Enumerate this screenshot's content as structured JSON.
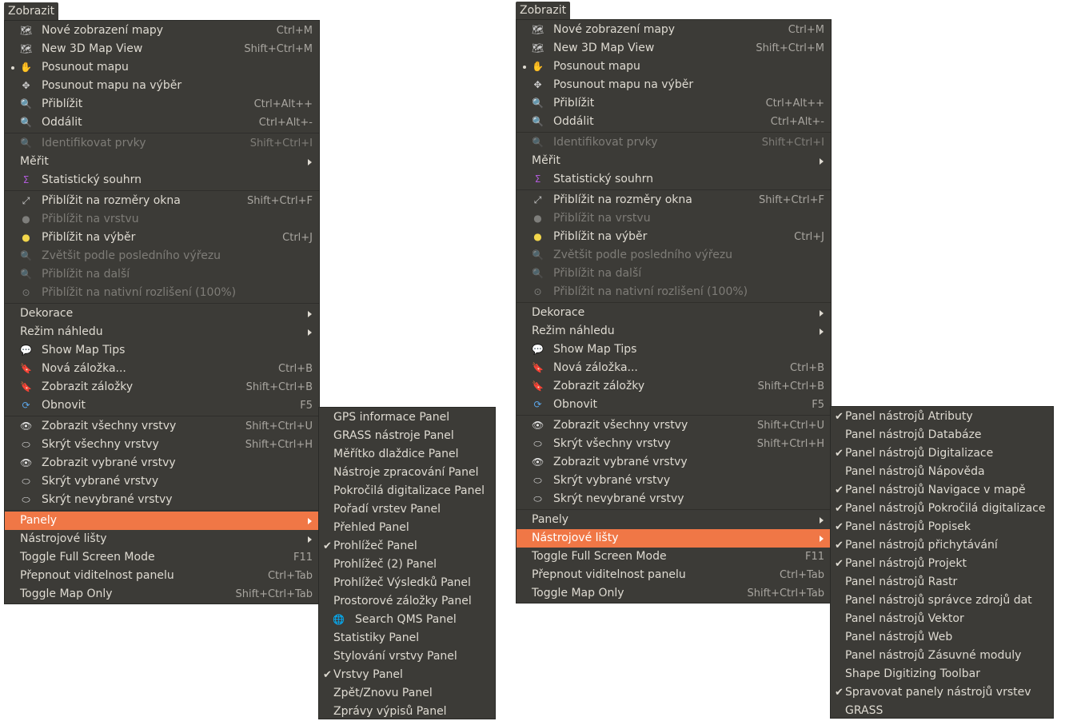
{
  "left": {
    "menu_title": "Zobrazit",
    "items": [
      {
        "label": "Nové zobrazení mapy",
        "shortcut": "Ctrl+M",
        "icon": "new-map-view-icon",
        "glyph": "🗺"
      },
      {
        "label": "New 3D Map View",
        "shortcut": "Shift+Ctrl+M",
        "icon": "new-3d-map-view-icon",
        "glyph": "🗺"
      },
      {
        "label": "Posunout mapu",
        "shortcut": "",
        "icon": "pan-hand-icon",
        "glyph": "✋",
        "bullet": true
      },
      {
        "label": "Posunout mapu na výběr",
        "shortcut": "",
        "icon": "pan-to-selection-icon",
        "glyph": "✥"
      },
      {
        "label": "Přiblížit",
        "shortcut": "Ctrl+Alt++",
        "icon": "zoom-in-icon",
        "glyph": "🔍"
      },
      {
        "label": "Oddálit",
        "shortcut": "Ctrl+Alt+-",
        "icon": "zoom-out-icon",
        "glyph": "🔍"
      },
      {
        "sep": true
      },
      {
        "label": "Identifikovat prvky",
        "shortcut": "Shift+Ctrl+I",
        "icon": "identify-icon",
        "glyph": "🔍",
        "disabled": true
      },
      {
        "label": "Měřit",
        "submenu": true,
        "noicon": true
      },
      {
        "label": "Statistický souhrn",
        "icon": "statistics-sigma-icon",
        "glyph": "Σ"
      },
      {
        "sep": true
      },
      {
        "label": "Přiblížit na rozměry okna",
        "shortcut": "Shift+Ctrl+F",
        "icon": "zoom-full-icon",
        "glyph": "⤢"
      },
      {
        "label": "Přiblížit na vrstvu",
        "icon": "zoom-layer-icon",
        "glyph": "●",
        "disabled": true
      },
      {
        "label": "Přiblížit na výběr",
        "shortcut": "Ctrl+J",
        "icon": "zoom-selection-icon",
        "glyph": "●"
      },
      {
        "label": "Zvětšit podle posledního výřezu",
        "icon": "zoom-last-icon",
        "glyph": "🔍",
        "disabled": true
      },
      {
        "label": "Přiblížit na další",
        "icon": "zoom-next-icon",
        "glyph": "🔍",
        "disabled": true
      },
      {
        "label": "Přiblížit na nativní rozlišení (100%)",
        "icon": "zoom-native-icon",
        "glyph": "⊙",
        "disabled": true
      },
      {
        "sep": true
      },
      {
        "label": "Dekorace",
        "submenu": true,
        "noicon": true
      },
      {
        "label": "Režim náhledu",
        "submenu": true,
        "noicon": true
      },
      {
        "label": "Show Map Tips",
        "icon": "map-tips-icon",
        "glyph": "💬"
      },
      {
        "label": "Nová záložka...",
        "shortcut": "Ctrl+B",
        "icon": "new-bookmark-icon",
        "glyph": "🔖"
      },
      {
        "label": "Zobrazit záložky",
        "shortcut": "Shift+Ctrl+B",
        "icon": "show-bookmarks-icon",
        "glyph": "🔖"
      },
      {
        "label": "Obnovit",
        "shortcut": "F5",
        "icon": "refresh-icon",
        "glyph": "⟳"
      },
      {
        "sep": true
      },
      {
        "label": "Zobrazit všechny vrstvy",
        "shortcut": "Shift+Ctrl+U",
        "icon": "show-all-layers-eye-icon",
        "glyph": "👁"
      },
      {
        "label": "Skrýt všechny vrstvy",
        "shortcut": "Shift+Ctrl+H",
        "icon": "hide-all-layers-icon",
        "glyph": "⬭"
      },
      {
        "label": "Zobrazit vybrané vrstvy",
        "icon": "show-selected-layers-icon",
        "glyph": "👁"
      },
      {
        "label": "Skrýt vybrané vrstvy",
        "icon": "hide-selected-layers-icon",
        "glyph": "⬭"
      },
      {
        "label": "Skrýt nevybrané vrstvy",
        "icon": "hide-deselected-layers-icon",
        "glyph": "⬭"
      },
      {
        "sep": true
      },
      {
        "label": "Panely",
        "submenu": true,
        "noicon": true,
        "highlight": true
      },
      {
        "label": "Nástrojové lišty",
        "submenu": true,
        "noicon": true
      },
      {
        "label": "Toggle Full Screen Mode",
        "shortcut": "F11",
        "noicon": true
      },
      {
        "label": "Přepnout viditelnost panelu",
        "shortcut": "Ctrl+Tab",
        "noicon": true
      },
      {
        "label": "Toggle Map Only",
        "shortcut": "Shift+Ctrl+Tab",
        "noicon": true
      }
    ],
    "submenu": [
      {
        "label": "GPS informace Panel"
      },
      {
        "label": "GRASS nástroje Panel"
      },
      {
        "label": "Měřítko dlaždice Panel"
      },
      {
        "label": "Nástroje zpracování Panel"
      },
      {
        "label": "Pokročilá digitalizace Panel"
      },
      {
        "label": "Pořadí vrstev Panel"
      },
      {
        "label": "Přehled Panel"
      },
      {
        "label": "Prohlížeč Panel",
        "checked": true
      },
      {
        "label": "Prohlížeč (2) Panel"
      },
      {
        "label": "Prohlížeč Výsledků Panel"
      },
      {
        "label": "Prostorové záložky Panel"
      },
      {
        "label": "Search QMS Panel",
        "icon": "search-qms-globe-icon",
        "glyph": "🌐"
      },
      {
        "label": "Statistiky Panel"
      },
      {
        "label": "Stylování vrstvy Panel"
      },
      {
        "label": "Vrstvy Panel",
        "checked": true
      },
      {
        "label": "Zpět/Znovu Panel"
      },
      {
        "label": "Zprávy výpisů Panel"
      }
    ]
  },
  "right": {
    "menu_title": "Zobrazit",
    "items": [
      {
        "label": "Nové zobrazení mapy",
        "shortcut": "Ctrl+M",
        "icon": "new-map-view-icon",
        "glyph": "🗺"
      },
      {
        "label": "New 3D Map View",
        "shortcut": "Shift+Ctrl+M",
        "icon": "new-3d-map-view-icon",
        "glyph": "🗺"
      },
      {
        "label": "Posunout mapu",
        "shortcut": "",
        "icon": "pan-hand-icon",
        "glyph": "✋",
        "bullet": true
      },
      {
        "label": "Posunout mapu na výběr",
        "shortcut": "",
        "icon": "pan-to-selection-icon",
        "glyph": "✥"
      },
      {
        "label": "Přiblížit",
        "shortcut": "Ctrl+Alt++",
        "icon": "zoom-in-icon",
        "glyph": "🔍"
      },
      {
        "label": "Oddálit",
        "shortcut": "Ctrl+Alt+-",
        "icon": "zoom-out-icon",
        "glyph": "🔍"
      },
      {
        "sep": true
      },
      {
        "label": "Identifikovat prvky",
        "shortcut": "Shift+Ctrl+I",
        "icon": "identify-icon",
        "glyph": "🔍",
        "disabled": true
      },
      {
        "label": "Měřit",
        "submenu": true,
        "noicon": true
      },
      {
        "label": "Statistický souhrn",
        "icon": "statistics-sigma-icon",
        "glyph": "Σ"
      },
      {
        "sep": true
      },
      {
        "label": "Přiblížit na rozměry okna",
        "shortcut": "Shift+Ctrl+F",
        "icon": "zoom-full-icon",
        "glyph": "⤢"
      },
      {
        "label": "Přiblížit na vrstvu",
        "icon": "zoom-layer-icon",
        "glyph": "●",
        "disabled": true
      },
      {
        "label": "Přiblížit na výběr",
        "shortcut": "Ctrl+J",
        "icon": "zoom-selection-icon",
        "glyph": "●"
      },
      {
        "label": "Zvětšit podle posledního výřezu",
        "icon": "zoom-last-icon",
        "glyph": "🔍",
        "disabled": true
      },
      {
        "label": "Přiblížit na další",
        "icon": "zoom-next-icon",
        "glyph": "🔍",
        "disabled": true
      },
      {
        "label": "Přiblížit na nativní rozlišení (100%)",
        "icon": "zoom-native-icon",
        "glyph": "⊙",
        "disabled": true
      },
      {
        "sep": true
      },
      {
        "label": "Dekorace",
        "submenu": true,
        "noicon": true
      },
      {
        "label": "Režim náhledu",
        "submenu": true,
        "noicon": true
      },
      {
        "label": "Show Map Tips",
        "icon": "map-tips-icon",
        "glyph": "💬"
      },
      {
        "label": "Nová záložka...",
        "shortcut": "Ctrl+B",
        "icon": "new-bookmark-icon",
        "glyph": "🔖"
      },
      {
        "label": "Zobrazit záložky",
        "shortcut": "Shift+Ctrl+B",
        "icon": "show-bookmarks-icon",
        "glyph": "🔖"
      },
      {
        "label": "Obnovit",
        "shortcut": "F5",
        "icon": "refresh-icon",
        "glyph": "⟳"
      },
      {
        "sep": true
      },
      {
        "label": "Zobrazit všechny vrstvy",
        "shortcut": "Shift+Ctrl+U",
        "icon": "show-all-layers-eye-icon",
        "glyph": "👁"
      },
      {
        "label": "Skrýt všechny vrstvy",
        "shortcut": "Shift+Ctrl+H",
        "icon": "hide-all-layers-icon",
        "glyph": "⬭"
      },
      {
        "label": "Zobrazit vybrané vrstvy",
        "icon": "show-selected-layers-icon",
        "glyph": "👁"
      },
      {
        "label": "Skrýt vybrané vrstvy",
        "icon": "hide-selected-layers-icon",
        "glyph": "⬭"
      },
      {
        "label": "Skrýt nevybrané vrstvy",
        "icon": "hide-deselected-layers-icon",
        "glyph": "⬭"
      },
      {
        "sep": true
      },
      {
        "label": "Panely",
        "submenu": true,
        "noicon": true
      },
      {
        "label": "Nástrojové lišty",
        "submenu": true,
        "noicon": true,
        "highlight": true
      },
      {
        "label": "Toggle Full Screen Mode",
        "shortcut": "F11",
        "noicon": true
      },
      {
        "label": "Přepnout viditelnost panelu",
        "shortcut": "Ctrl+Tab",
        "noicon": true
      },
      {
        "label": "Toggle Map Only",
        "shortcut": "Shift+Ctrl+Tab",
        "noicon": true
      }
    ],
    "submenu": [
      {
        "label": "Panel nástrojů Atributy",
        "checked": true
      },
      {
        "label": "Panel nástrojů Databáze"
      },
      {
        "label": "Panel nástrojů Digitalizace",
        "checked": true
      },
      {
        "label": "Panel nástrojů Nápověda"
      },
      {
        "label": "Panel nástrojů Navigace v mapě",
        "checked": true
      },
      {
        "label": "Panel nástrojů Pokročilá digitalizace",
        "checked": true
      },
      {
        "label": "Panel nástrojů Popisek",
        "checked": true
      },
      {
        "label": "Panel nástrojů přichytávání",
        "checked": true
      },
      {
        "label": "Panel nástrojů Projekt",
        "checked": true
      },
      {
        "label": "Panel nástrojů Rastr"
      },
      {
        "label": "Panel nástrojů správce zdrojů dat"
      },
      {
        "label": "Panel nástrojů Vektor"
      },
      {
        "label": "Panel nástrojů Web"
      },
      {
        "label": "Panel nástrojů Zásuvné moduly"
      },
      {
        "label": "Shape Digitizing Toolbar"
      },
      {
        "label": "Spravovat panely nástrojů vrstev",
        "checked": true
      },
      {
        "label": "GRASS"
      }
    ]
  },
  "colors": {
    "menu_bg": "#3c3b37",
    "highlight": "#f07746",
    "text": "#dfdbd2",
    "disabled_text": "#7e7c77"
  }
}
